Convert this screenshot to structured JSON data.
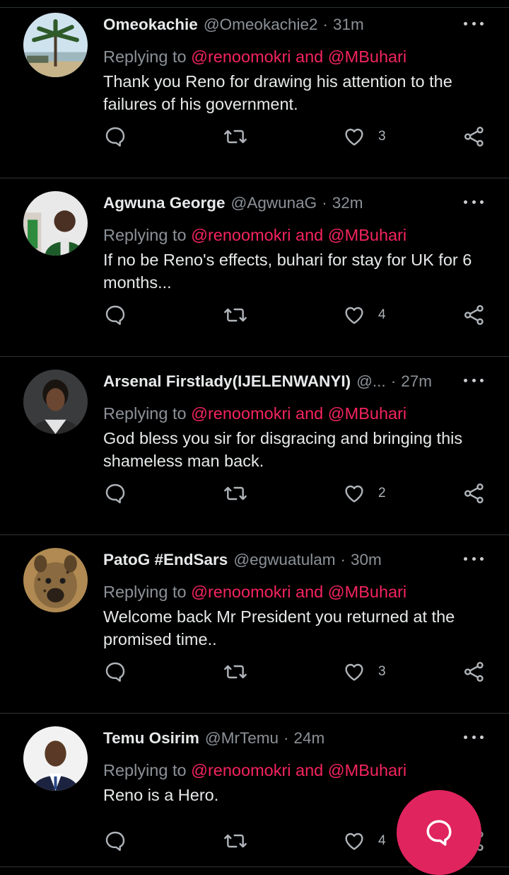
{
  "colors": {
    "background": "#000000",
    "mention": "#f4245e",
    "fab": "#e0245e",
    "muted": "#8b9197"
  },
  "replying_prefix": "Replying to",
  "tweets": [
    {
      "name": "Omeokachie",
      "handle": "@Omeokachie2",
      "dot": "·",
      "time": "31m",
      "mentions": "@renoomokri and @MBuhari",
      "text": "Thank you Reno for drawing his attention to the failures of his government.",
      "likes": "3",
      "avatar": "palm-beach-avatar"
    },
    {
      "name": "Agwuna George",
      "handle": "@AgwunaG",
      "dot": "·",
      "time": "32m",
      "mentions": "@renoomokri and @MBuhari",
      "text": "If no be Reno's effects, buhari for stay for UK for 6 months...",
      "likes": "4",
      "avatar": "man-selfie-avatar"
    },
    {
      "name": "Arsenal Firstlady(IJELENWANYI)",
      "handle": "@...",
      "dot": "·",
      "time": "27m",
      "mentions": "@renoomokri and @MBuhari",
      "text": "God bless you sir for disgracing and bringing this shameless man back.",
      "likes": "2",
      "avatar": "woman-portrait-avatar"
    },
    {
      "name": "PatoG #EndSars",
      "handle": "@egwuatulam",
      "dot": "·",
      "time": "30m",
      "mentions": "@renoomokri and @MBuhari",
      "text": "Welcome back Mr President you returned at the promised time..",
      "likes": "3",
      "avatar": "hyena-avatar"
    },
    {
      "name": "Temu Osirim",
      "handle": "@MrTemu",
      "dot": "·",
      "time": "24m",
      "mentions": "@renoomokri and @MBuhari",
      "text": "Reno is a Hero.",
      "likes": "4",
      "avatar": "man-suit-avatar"
    }
  ]
}
